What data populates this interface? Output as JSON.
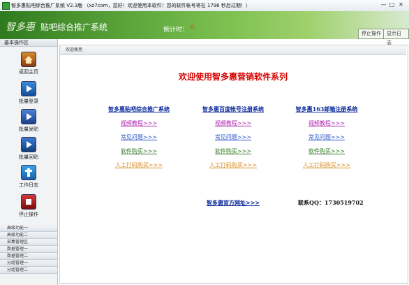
{
  "window": {
    "title": "智多惠贴吧综合推广系统 V2.3版 （xz7com，您好！欢迎使用本软件！您的软件帐号将在 1796 秒后过期！）",
    "minimize": "—",
    "maximize": "□",
    "close": "✕"
  },
  "banner": {
    "logo": "智多惠",
    "product": "贴吧综合推广系统",
    "countdown_label": "倒计时：",
    "countdown_value": "0",
    "stop_button": "停止操作",
    "log_button": "显示日志"
  },
  "sidebar": {
    "header": "基本操作区",
    "items": [
      {
        "label": "返回主页",
        "icon": "home-icon"
      },
      {
        "label": "批量登录",
        "icon": "play-icon"
      },
      {
        "label": "批量发贴",
        "icon": "play-icon"
      },
      {
        "label": "批量回贴",
        "icon": "play-icon"
      },
      {
        "label": "工作日志",
        "icon": "log-icon"
      },
      {
        "label": "停止操作",
        "icon": "stop-icon"
      }
    ],
    "accordion": [
      "高级功能一",
      "高级功能二",
      "采集管理区",
      "数据管理一",
      "数据管理二",
      "分组管理一",
      "分组管理二"
    ]
  },
  "main": {
    "tab": "欢迎使用",
    "welcome": "欢迎使用智多惠营销软件系列",
    "columns": [
      {
        "title": "智多惠贴吧综合推广系统",
        "links": [
          "视频教程>>>",
          "常见问题>>>",
          "软件购买>>>",
          "人工打码购买>>>"
        ]
      },
      {
        "title": "智多惠百度帐号注册系统",
        "links": [
          "视频教程>>>",
          "常见问题>>>",
          "软件购买>>>",
          "人工打码购买>>>"
        ]
      },
      {
        "title": "智多惠163邮箱注册系统",
        "links": [
          "视频教程>>>",
          "常见问题>>>",
          "软件购买>>>",
          "人工打码购买>>>"
        ]
      }
    ],
    "site_link": "智多惠官方网址>>>",
    "qq": "联系QQ：1730519702"
  },
  "colors": {
    "banner_green": "#5aa33a",
    "welcome_red": "#d80000",
    "title_blue": "#0b2a9c",
    "video_purple": "#b020b0",
    "faq_blue": "#2a55c8",
    "buy_green": "#2f7a1f",
    "captcha_orange": "#d88b1f"
  }
}
